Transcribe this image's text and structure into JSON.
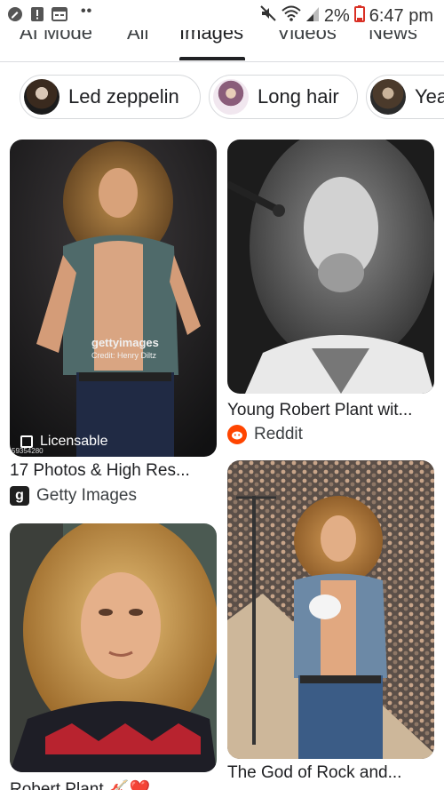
{
  "status_bar": {
    "battery": "2%",
    "time": "6:47 pm",
    "icons": [
      "edit-icon",
      "alert-icon",
      "calendar-icon",
      "more-dots-icon",
      "mute-icon",
      "wifi-icon",
      "signal-icon",
      "battery-icon"
    ]
  },
  "tabs": [
    {
      "label": "AI Mode",
      "active": false
    },
    {
      "label": "All",
      "active": false
    },
    {
      "label": "Images",
      "active": true
    },
    {
      "label": "Videos",
      "active": false
    },
    {
      "label": "News",
      "active": false
    }
  ],
  "chips": [
    {
      "label": "Led zeppelin"
    },
    {
      "label": "Long hair"
    },
    {
      "label": "Yea"
    }
  ],
  "results": [
    {
      "title": "17 Photos & High Res...",
      "source": "Getty Images",
      "badge": "Licensable",
      "watermark": "gettyimages",
      "credit": "Credit: Henry Diltz",
      "image_id": "59354280"
    },
    {
      "title": "Young Robert Plant wit...",
      "source": "Reddit"
    },
    {
      "title": "Robert Plant",
      "title_emoji": "🎸❤️..."
    },
    {
      "title": "The God of Rock and..."
    }
  ],
  "colors": {
    "reddit": "#ff4500",
    "getty": "#1f1f1f",
    "tab_indicator": "#202124"
  }
}
